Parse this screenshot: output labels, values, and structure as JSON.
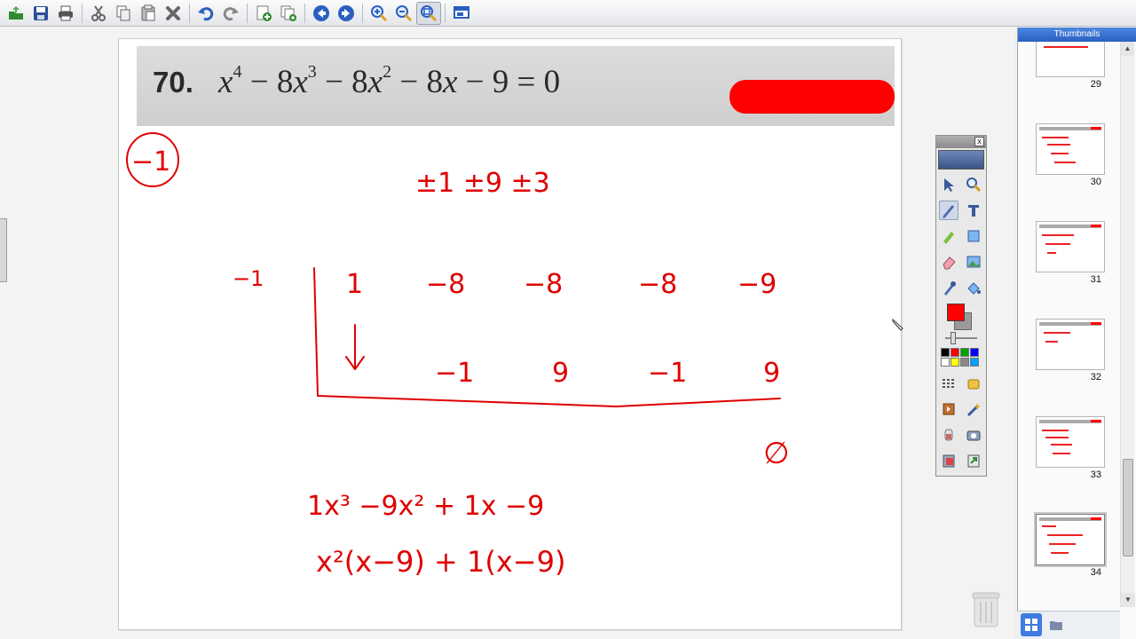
{
  "toolbar": {
    "buttons": [
      {
        "name": "open-icon",
        "color": "#2e8b2e"
      },
      {
        "name": "save-icon",
        "color": "#2a4f9a"
      },
      {
        "name": "print-icon",
        "color": "#555555"
      },
      {
        "name": "cut-icon",
        "color": "#666666"
      },
      {
        "name": "copy-icon",
        "color": "#666666"
      },
      {
        "name": "paste-icon",
        "color": "#666666"
      },
      {
        "name": "delete-icon",
        "color": "#666666"
      },
      {
        "name": "undo-icon",
        "color": "#2a5fbf"
      },
      {
        "name": "redo-icon",
        "color": "#888888"
      },
      {
        "name": "add-page-icon",
        "color": "#2e8b2e"
      },
      {
        "name": "duplicate-page-icon",
        "color": "#2e8b2e"
      },
      {
        "name": "previous-page-icon",
        "color": "#2a5fbf"
      },
      {
        "name": "next-page-icon",
        "color": "#2a5fbf"
      },
      {
        "name": "zoom-in-icon",
        "color": "#2a5fbf"
      },
      {
        "name": "zoom-out-icon",
        "color": "#2a5fbf"
      },
      {
        "name": "zoom-fit-icon",
        "color": "#2a5fbf"
      },
      {
        "name": "screen-icon",
        "color": "#2a5fbf"
      }
    ],
    "active_button": "zoom-fit-icon"
  },
  "problem": {
    "number": "70.",
    "equation": {
      "t1": "x",
      "e1": "4",
      "op1": "−",
      "c2": "8",
      "t2": "x",
      "e2": "3",
      "op2": "−",
      "c3": "8",
      "t3": "x",
      "e3": "2",
      "op3": "−",
      "c4": "8",
      "t4": "x",
      "op4": "−",
      "c5": "9",
      "eq": "= 0"
    },
    "redaction_color": "#ff0000"
  },
  "handwriting": {
    "root": "−1",
    "candidates": "±1  ±9 ±3",
    "divisor": "−1",
    "coefficients": [
      "1",
      "−8",
      "−8",
      "−8",
      "−9"
    ],
    "products": [
      "−1",
      "9",
      "−1",
      "9"
    ],
    "remainder": "∅",
    "quotient": "1x³  −9x²  + 1x   −9",
    "factored": "x²(x−9) + 1(x−9)",
    "ink_color": "#e00000"
  },
  "palette": {
    "close_label": "x",
    "tools": [
      [
        "select-icon",
        "zoom-icon"
      ],
      [
        "pen-icon",
        "text-icon"
      ],
      [
        "highlighter-icon",
        "shape-icon"
      ],
      [
        "eraser-icon",
        "image-icon"
      ],
      [
        "eyedropper-icon",
        "fill-icon"
      ]
    ],
    "active_tool": "pen-icon",
    "foreground_color": "#ff0000",
    "background_color": "#9a9a9a",
    "swatches": [
      "#000000",
      "#ff0000",
      "#00a000",
      "#0000ff",
      "#ffffff",
      "#ffff00",
      "#888888",
      "#00a0ff"
    ],
    "lower_tools": [
      [
        "line-style-icon",
        "fill-style-icon"
      ],
      [
        "undo-tool-icon",
        "magic-icon"
      ],
      [
        "recorder-icon",
        "camera-icon"
      ],
      [
        "clipboard-icon",
        "export-icon"
      ]
    ]
  },
  "thumbnails": {
    "title": "Thumbnails",
    "pages": [
      "29",
      "30",
      "31",
      "32",
      "33",
      "34"
    ],
    "selected": "34"
  }
}
